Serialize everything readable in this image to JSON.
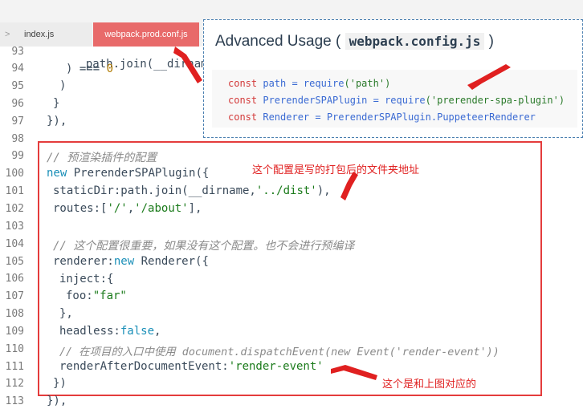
{
  "tabs": {
    "index_label": "index.js",
    "chevron": ">",
    "webpack_label": "webpack.prod.conf.js"
  },
  "gutter": {
    "lines": [
      "93",
      "94",
      "95",
      "96",
      "97",
      "98",
      "99",
      "100",
      "101",
      "102",
      "103",
      "104",
      "105",
      "106",
      "107",
      "108",
      "109",
      "110",
      "111",
      "112",
      "113"
    ]
  },
  "code": {
    "l93": "path.join(__dirname",
    "l94_a": ") === ",
    "l94_b": "0",
    "l95": ")",
    "l96": "}",
    "l97": "}),",
    "l99": "// 预渲染插件的配置",
    "l100_kw": "new",
    "l100_rest": " PrerenderSPAPlugin({",
    "l101_a": "staticDir:path.join(__dirname,",
    "l101_b": "'../dist'",
    "l101_c": "),",
    "l102_a": "routes:[",
    "l102_b": "'/'",
    "l102_c": ",",
    "l102_d": "'/about'",
    "l102_e": "],",
    "l104": "// 这个配置很重要，如果没有这个配置。也不会进行预编译",
    "l105_a": "renderer:",
    "l105_kw": "new",
    "l105_b": " Renderer({",
    "l106": "inject:{",
    "l107_a": "foo:",
    "l107_b": "\"far\"",
    "l108": "},",
    "l109_a": "headless:",
    "l109_b": "false",
    "l109_c": ",",
    "l110": "// 在项目的入口中使用 document.dispatchEvent(new Event('render-event'))",
    "l111_a": "renderAfterDocumentEvent:",
    "l111_b": "'render-event'",
    "l112": "})",
    "l113": "}),"
  },
  "annotations": {
    "a1": "这个配置是写的打包后的文件夹地址",
    "a2": "这个是和上图对应的"
  },
  "doc": {
    "title_prefix": "Advanced Usage (",
    "title_code": "webpack.config.js",
    "title_suffix": ")",
    "line1_kw": "const",
    "line1_rest": " path = ",
    "line1_fn": "require",
    "line1_str": "('path')",
    "line2_kw": "const",
    "line2_rest": " PrerenderSPAPlugin = ",
    "line2_fn": "require",
    "line2_str": "('prerender-spa-plugin')",
    "line3_kw": "const",
    "line3_rest": " Renderer = PrerenderSPAPlugin.PuppeteerRenderer"
  },
  "colors": {
    "highlight_box": "#e43c3c",
    "arrow": "#e02020",
    "active_tab": "#e86a6a",
    "doc_border": "#4a7fb0"
  }
}
